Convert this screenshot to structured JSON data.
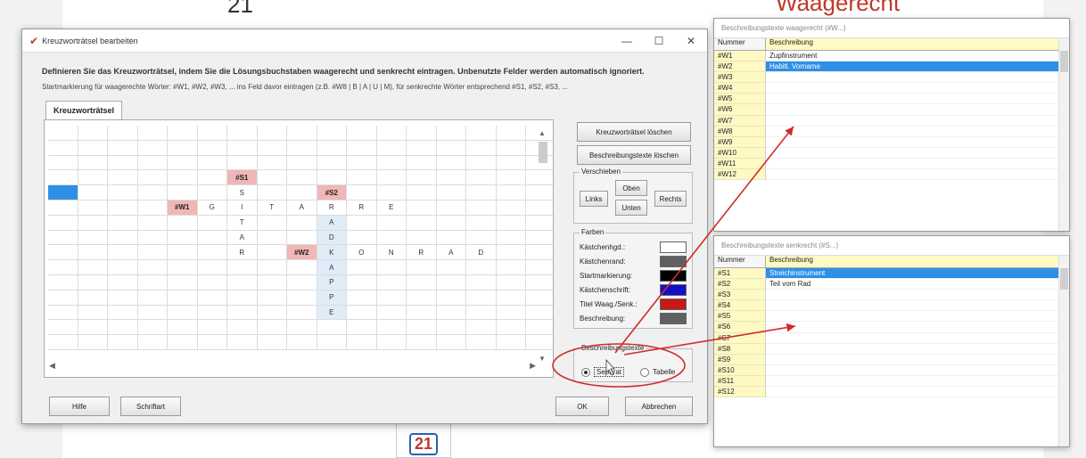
{
  "background": {
    "page_number_top": "21",
    "red_title_partial": "Waagerecht",
    "page_badge": "21"
  },
  "dialog": {
    "title": "Kreuzworträtsel bearbeiten",
    "window_buttons": [
      "—",
      "☐",
      "✕"
    ],
    "instruction_main": "Definieren Sie das Kreuzworträtsel, indem Sie die Lösungsbuchstaben waagerecht und senkrecht eintragen. Unbenutzte Felder werden automatisch ignoriert.",
    "instruction_sub": "Startmarkierung für waagerechte Wörter: #W1, #W2, #W3, ... ins Feld davor eintragen (z.B. #W8 | B | A | U | M), für senkrechte Wörter entsprechend #S1, #S2, #S3, ...",
    "tab_label": "Kreuzworträtsel",
    "grid_rows": [
      [
        "",
        "",
        "",
        "",
        "",
        "",
        "",
        "",
        "",
        "",
        "",
        "",
        "",
        "",
        "",
        "",
        ""
      ],
      [
        "",
        "",
        "",
        "",
        "",
        "",
        "",
        "",
        "",
        "",
        "",
        "",
        "",
        "",
        "",
        "",
        ""
      ],
      [
        "",
        "",
        "",
        "",
        "",
        "",
        "",
        "",
        "",
        "",
        "",
        "",
        "",
        "",
        "",
        "",
        ""
      ],
      [
        "",
        "",
        "",
        "",
        "",
        "",
        "#S1",
        "",
        "",
        "",
        "",
        "",
        "",
        "",
        "",
        "",
        ""
      ],
      [
        "",
        "",
        "",
        "",
        "",
        "",
        "S",
        "",
        "",
        "#S2",
        "",
        "",
        "",
        "",
        "",
        "",
        ""
      ],
      [
        "",
        "",
        "",
        "",
        "#W1",
        "G",
        "I",
        "T",
        "A",
        "R",
        "R",
        "E",
        "",
        "",
        "",
        "",
        ""
      ],
      [
        "",
        "",
        "",
        "",
        "",
        "",
        "T",
        "",
        "",
        "A",
        "",
        "",
        "",
        "",
        "",
        "",
        ""
      ],
      [
        "",
        "",
        "",
        "",
        "",
        "",
        "A",
        "",
        "",
        "D",
        "",
        "",
        "",
        "",
        "",
        "",
        ""
      ],
      [
        "",
        "",
        "",
        "",
        "",
        "",
        "R",
        "",
        "#W2",
        "K",
        "O",
        "N",
        "R",
        "A",
        "D",
        "",
        ""
      ],
      [
        "",
        "",
        "",
        "",
        "",
        "",
        "",
        "",
        "",
        "A",
        "",
        "",
        "",
        "",
        "",
        "",
        ""
      ],
      [
        "",
        "",
        "",
        "",
        "",
        "",
        "",
        "",
        "",
        "P",
        "",
        "",
        "",
        "",
        "",
        "",
        ""
      ],
      [
        "",
        "",
        "",
        "",
        "",
        "",
        "",
        "",
        "",
        "P",
        "",
        "",
        "",
        "",
        "",
        "",
        ""
      ],
      [
        "",
        "",
        "",
        "",
        "",
        "",
        "",
        "",
        "",
        "E",
        "",
        "",
        "",
        "",
        "",
        "",
        ""
      ],
      [
        "",
        "",
        "",
        "",
        "",
        "",
        "",
        "",
        "",
        "",
        "",
        "",
        "",
        "",
        "",
        "",
        ""
      ],
      [
        "",
        "",
        "",
        "",
        "",
        "",
        "",
        "",
        "",
        "",
        "",
        "",
        "",
        "",
        "",
        "",
        ""
      ]
    ],
    "selected_cell": {
      "row": 4,
      "col": 0
    },
    "buttons": {
      "delete_grid": "Kreuzworträtsel löschen",
      "delete_descriptions": "Beschreibungstexte löschen"
    },
    "shift_group": {
      "title": "Verschieben",
      "left": "Links",
      "up": "Oben",
      "down": "Unten",
      "right": "Rechts"
    },
    "colors_group": {
      "title": "Farben",
      "items": [
        {
          "label": "Kästchenhgd.:",
          "color": "#ffffff"
        },
        {
          "label": "Kästchenrand:",
          "color": "#606060"
        },
        {
          "label": "Startmarkierung:",
          "color": "#000000"
        },
        {
          "label": "Kästchenschrift:",
          "color": "#1010c8"
        },
        {
          "label": "Titel Waag./Senk.:",
          "color": "#c81818"
        },
        {
          "label": "Beschreibung:",
          "color": "#606060"
        }
      ]
    },
    "desc_group": {
      "title": "Beschreibungstexte",
      "option_separate": "Separat",
      "option_table": "Tabelle"
    },
    "bottom_buttons": {
      "font": "Hilfe",
      "schriftart": "Schriftart",
      "ok": "OK",
      "cancel": "Abbrechen"
    }
  },
  "panel_across": {
    "title": "Beschreibungstexte waagerecht (#W...)",
    "col_number": "Nummer",
    "col_desc": "Beschreibung",
    "rows": [
      {
        "num": "#W1",
        "desc": "Zupfinstrument"
      },
      {
        "num": "#W2",
        "desc": "Habitl. Vorname"
      },
      {
        "num": "#W3",
        "desc": ""
      },
      {
        "num": "#W4",
        "desc": ""
      },
      {
        "num": "#W5",
        "desc": ""
      },
      {
        "num": "#W6",
        "desc": ""
      },
      {
        "num": "#W7",
        "desc": ""
      },
      {
        "num": "#W8",
        "desc": ""
      },
      {
        "num": "#W9",
        "desc": ""
      },
      {
        "num": "#W10",
        "desc": ""
      },
      {
        "num": "#W11",
        "desc": ""
      },
      {
        "num": "#W12",
        "desc": ""
      }
    ],
    "selected_index": 1
  },
  "panel_down": {
    "title": "Beschreibungstexte senkrecht (#S...)",
    "col_number": "Nummer",
    "col_desc": "Beschreibung",
    "rows": [
      {
        "num": "#S1",
        "desc": "Streichinstrument"
      },
      {
        "num": "#S2",
        "desc": "Teil vom Rad"
      },
      {
        "num": "#S3",
        "desc": ""
      },
      {
        "num": "#S4",
        "desc": ""
      },
      {
        "num": "#S5",
        "desc": ""
      },
      {
        "num": "#S6",
        "desc": ""
      },
      {
        "num": "#S7",
        "desc": ""
      },
      {
        "num": "#S8",
        "desc": ""
      },
      {
        "num": "#S9",
        "desc": ""
      },
      {
        "num": "#S10",
        "desc": ""
      },
      {
        "num": "#S11",
        "desc": ""
      },
      {
        "num": "#S12",
        "desc": ""
      }
    ],
    "selected_index": 0
  },
  "accent": {
    "selection": "#2e8fe6",
    "marker": "#f1b6b6",
    "annotation": "#d12a2a"
  }
}
